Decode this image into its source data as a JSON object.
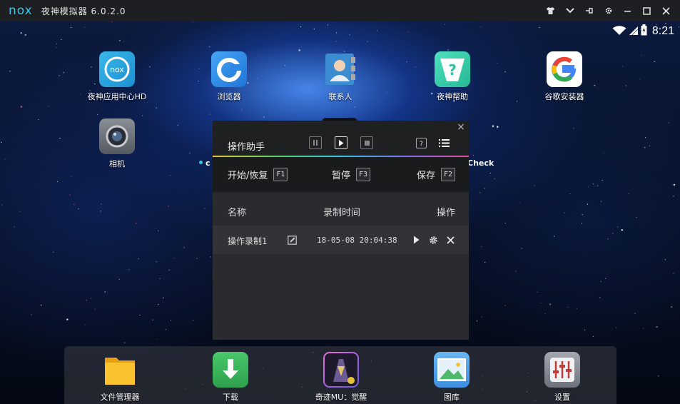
{
  "window": {
    "logo_text": "nox",
    "title": "夜神模拟器 6.0.2.0",
    "controls": [
      {
        "name": "shirt-icon"
      },
      {
        "name": "chevron-down-icon"
      },
      {
        "name": "pin-icon"
      },
      {
        "name": "gear-icon"
      },
      {
        "name": "minimize-icon"
      },
      {
        "name": "maximize-icon"
      },
      {
        "name": "close-icon"
      }
    ]
  },
  "status_bar": {
    "time": "8:21",
    "icons": [
      "wifi-icon",
      "signal-icon",
      "battery-icon"
    ]
  },
  "desktop": {
    "apps_row1": [
      {
        "label": "夜神应用中心HD",
        "icon": "nox-app-center-icon",
        "color": "#2aa3dc"
      },
      {
        "label": "浏览器",
        "icon": "browser-icon",
        "color": "#2e8fe8"
      },
      {
        "label": "联系人",
        "icon": "contacts-icon",
        "color": "#3a8fd0"
      },
      {
        "label": "夜神帮助",
        "icon": "help-icon",
        "color": "#3fd4b0"
      },
      {
        "label": "谷歌安装器",
        "icon": "google-installer-icon",
        "color": "#ffffff"
      }
    ],
    "apps_row2": [
      {
        "label": "相机",
        "icon": "camera-icon",
        "color": "#6b6f78"
      }
    ],
    "partial_label_right": "Check",
    "partial_label_left": "c"
  },
  "dock": {
    "apps": [
      {
        "label": "文件管理器",
        "icon": "folder-icon",
        "color": "#f5b821"
      },
      {
        "label": "下载",
        "icon": "download-icon",
        "color": "#3cba5c"
      },
      {
        "label": "奇迹MU：觉醒",
        "icon": "game-icon",
        "color": "#5a4a8a"
      },
      {
        "label": "图库",
        "icon": "gallery-icon",
        "color": "#5aa8e8"
      },
      {
        "label": "设置",
        "icon": "settings-icon",
        "color": "#8a8e98"
      }
    ]
  },
  "dialog": {
    "close": "×",
    "title": "操作助手",
    "controls": [
      "pause-icon",
      "play-icon",
      "stop-icon",
      "help-icon",
      "list-icon"
    ],
    "hotkeys": [
      {
        "label": "开始/恢复",
        "key": "F1"
      },
      {
        "label": "暂停",
        "key": "F3"
      },
      {
        "label": "保存",
        "key": "F2"
      }
    ],
    "columns": {
      "name": "名称",
      "time": "录制时间",
      "action": "操作"
    },
    "rows": [
      {
        "name": "操作录制1",
        "time": "18-05-08 20:04:38"
      }
    ]
  }
}
